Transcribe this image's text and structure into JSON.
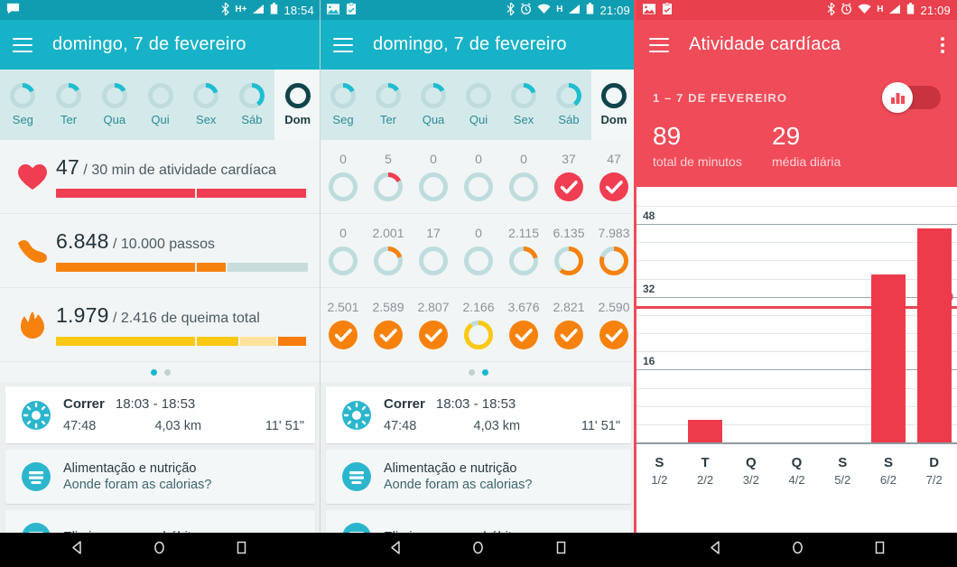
{
  "panel1": {
    "statusbar": {
      "time": "18:54",
      "icons_left": [
        "message-icon"
      ],
      "icons_right": [
        "bluetooth-icon",
        "hplus-icon",
        "signal-icon",
        "battery-icon"
      ],
      "network": "H+"
    },
    "appbar": {
      "title": "domingo, 7 de fevereiro",
      "menu": "hamburger-icon"
    },
    "week": {
      "days": [
        {
          "label": "Seg",
          "progress": 18,
          "selected": false
        },
        {
          "label": "Ter",
          "progress": 16,
          "selected": false
        },
        {
          "label": "Qua",
          "progress": 17,
          "selected": false
        },
        {
          "label": "Qui",
          "progress": 0,
          "selected": false
        },
        {
          "label": "Sex",
          "progress": 20,
          "selected": false
        },
        {
          "label": "Sáb",
          "progress": 40,
          "selected": false
        },
        {
          "label": "Dom",
          "progress": 100,
          "selected": true
        }
      ]
    },
    "metrics": [
      {
        "icon": "heart-icon",
        "value": "47",
        "rest": "/ 30 min de atividade cardíaca",
        "segments": [
          {
            "pct": 56,
            "color": "#ef3d51"
          },
          {
            "pct": 44,
            "color": "#ef3d51"
          }
        ],
        "track": "#c8dcdc"
      },
      {
        "icon": "shoe-icon",
        "value": "6.848",
        "rest": "/ 10.000 passos",
        "segments": [
          {
            "pct": 56,
            "color": "#f6820d"
          },
          {
            "pct": 12,
            "color": "#f6820d"
          }
        ],
        "track": "#c8dcdc"
      },
      {
        "icon": "flame-icon",
        "value": "1.979",
        "rest": "/ 2.416 de queima total",
        "segments": [
          {
            "pct": 56,
            "color": "#fbc913"
          },
          {
            "pct": 17,
            "color": "#fbc913"
          },
          {
            "pct": 15,
            "color": "#fde29b"
          },
          {
            "pct": 12,
            "color": "#f77c0c"
          }
        ],
        "track": "#f2f5f5"
      }
    ],
    "pager": {
      "dots": 2,
      "active": 0
    },
    "cards": [
      {
        "type": "activity",
        "icon": "run-icon",
        "name": "Correr",
        "time": "18:03 - 18:53",
        "duration": "47:48",
        "distance": "4,03 km",
        "pace": "11' 51\""
      },
      {
        "type": "info",
        "icon": "list-icon",
        "title": "Alimentação e nutrição",
        "subtitle": "Aonde foram as calorias?"
      },
      {
        "type": "info",
        "icon": "list-icon",
        "title": "Elimine os maus hábitos",
        "subtitle": ""
      }
    ]
  },
  "panel2": {
    "statusbar": {
      "time": "21:09",
      "icons_left": [
        "image-icon",
        "clipboard-icon"
      ],
      "icons_right": [
        "bluetooth-icon",
        "alarm-icon",
        "wifi-icon",
        "hplus-icon",
        "signal-icon",
        "battery-icon"
      ],
      "network": "H"
    },
    "appbar": {
      "title": "domingo, 7 de fevereiro",
      "menu": "hamburger-icon"
    },
    "week": {
      "days": [
        {
          "label": "Seg",
          "progress": 18,
          "selected": false
        },
        {
          "label": "Ter",
          "progress": 16,
          "selected": false
        },
        {
          "label": "Qua",
          "progress": 17,
          "selected": false
        },
        {
          "label": "Qui",
          "progress": 0,
          "selected": false
        },
        {
          "label": "Sex",
          "progress": 20,
          "selected": false
        },
        {
          "label": "Sáb",
          "progress": 40,
          "selected": false
        },
        {
          "label": "Dom",
          "progress": 100,
          "selected": true
        }
      ]
    },
    "rows": [
      {
        "name": "heart-row",
        "color": "#ef3d51",
        "cells": [
          {
            "value": "0",
            "progress": 0,
            "complete": false
          },
          {
            "value": "5",
            "progress": 17,
            "complete": false
          },
          {
            "value": "0",
            "progress": 0,
            "complete": false
          },
          {
            "value": "0",
            "progress": 0,
            "complete": false
          },
          {
            "value": "0",
            "progress": 0,
            "complete": false
          },
          {
            "value": "37",
            "progress": 100,
            "complete": true
          },
          {
            "value": "47",
            "progress": 100,
            "complete": true
          }
        ]
      },
      {
        "name": "steps-row",
        "color": "#f6820d",
        "cells": [
          {
            "value": "0",
            "progress": 0,
            "complete": false
          },
          {
            "value": "2.001",
            "progress": 20,
            "complete": false
          },
          {
            "value": "17",
            "progress": 0,
            "complete": false
          },
          {
            "value": "0",
            "progress": 0,
            "complete": false
          },
          {
            "value": "2.115",
            "progress": 21,
            "complete": false
          },
          {
            "value": "6.135",
            "progress": 61,
            "complete": false
          },
          {
            "value": "7.983",
            "progress": 80,
            "complete": false
          }
        ]
      },
      {
        "name": "calories-row",
        "color": "#f6820d",
        "cells": [
          {
            "value": "2.501",
            "progress": 100,
            "complete": true
          },
          {
            "value": "2.589",
            "progress": 100,
            "complete": true
          },
          {
            "value": "2.807",
            "progress": 100,
            "complete": true
          },
          {
            "value": "2.166",
            "progress": 90,
            "complete": false,
            "color": "#fbc913"
          },
          {
            "value": "3.676",
            "progress": 100,
            "complete": true
          },
          {
            "value": "2.821",
            "progress": 100,
            "complete": true
          },
          {
            "value": "2.590",
            "progress": 100,
            "complete": true
          }
        ]
      }
    ],
    "pager": {
      "dots": 2,
      "active": 1
    },
    "cards": [
      {
        "type": "activity",
        "icon": "run-icon",
        "name": "Correr",
        "time": "18:03 - 18:53",
        "duration": "47:48",
        "distance": "4,03 km",
        "pace": "11' 51\""
      },
      {
        "type": "info",
        "icon": "list-icon",
        "title": "Alimentação e nutrição",
        "subtitle": "Aonde foram as calorias?"
      },
      {
        "type": "info",
        "icon": "list-icon",
        "title": "Elimine os maus hábitos",
        "subtitle": ""
      }
    ]
  },
  "panel3": {
    "statusbar": {
      "time": "21:09",
      "icons_left": [
        "image-icon",
        "clipboard-icon"
      ],
      "icons_right": [
        "bluetooth-icon",
        "alarm-icon",
        "wifi-icon",
        "hplus-icon",
        "signal-icon",
        "battery-icon"
      ],
      "network": "H"
    },
    "appbar": {
      "title": "Atividade cardíaca",
      "menu": "hamburger-icon",
      "overflow": "kebab-icon"
    },
    "summary": {
      "range": "1 – 7 DE FEVEREIRO",
      "toggle_icon": "bar-chart-icon",
      "total_value": "89",
      "total_label": "total de minutos",
      "avg_value": "29",
      "avg_label": "média diária"
    },
    "accent": "#ef4b58"
  },
  "chart_data": {
    "type": "bar",
    "title": "Atividade cardíaca",
    "categories": [
      "S",
      "T",
      "Q",
      "Q",
      "S",
      "S",
      "D"
    ],
    "sublabels": [
      "1/2",
      "2/2",
      "3/2",
      "4/2",
      "5/2",
      "6/2",
      "7/2"
    ],
    "values": [
      0,
      5,
      0,
      0,
      0,
      37,
      47
    ],
    "ylim": [
      0,
      52
    ],
    "yticks": [
      16,
      32,
      48
    ],
    "ytick_labels": [
      "16",
      "32",
      "48"
    ],
    "gridline_step": 4,
    "goal": 30,
    "goal_label": "30",
    "goal_color": "#ea4452",
    "bar_color": "#ee3b4c",
    "xlabel": "",
    "ylabel": "",
    "grid": true,
    "legend": "none"
  },
  "navbar": {
    "buttons": [
      "back-icon",
      "home-icon",
      "recents-icon"
    ],
    "count": 3
  }
}
